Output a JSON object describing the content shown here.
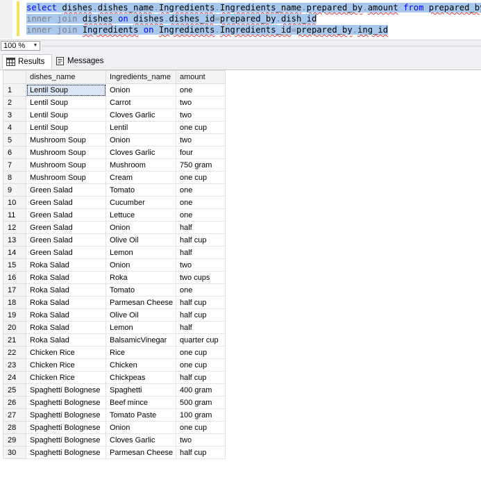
{
  "editor": {
    "line1": {
      "kw1": "select",
      "t1": "dishes",
      "d1": ".",
      "t2": "dishes_name",
      "d2": ".",
      "t3": "Ingredients",
      "d3": ".",
      "t4": "Ingredients_name",
      "d4": ".",
      "t5": "prepared_by",
      "d5": ".",
      "t6": "amount",
      "kw2": "from",
      "t7": "prepared_by"
    },
    "line2": {
      "kw1": "inner join",
      "t1": "dishes",
      "kw2": "on",
      "t2": "dishes",
      "d1": ".",
      "t3": "dishes_id",
      "eq": "=",
      "t4": "prepared_by",
      "d2": ".",
      "t5": "dish_id"
    },
    "line3": {
      "kw1": "inner join",
      "t1": "Ingredients",
      "kw2": "on",
      "t2": "Ingredients",
      "d1": ".",
      "t3": "Ingredients_id",
      "eq": "=",
      "t4": "prepared_by",
      "d2": ".",
      "t5": "ing_id"
    }
  },
  "zoom": {
    "value": "100 %"
  },
  "tabs": {
    "results": "Results",
    "messages": "Messages"
  },
  "grid": {
    "columns": [
      "dishes_name",
      "Ingredients_name",
      "amount"
    ],
    "rows": [
      [
        "1",
        "Lentil Soup",
        "Onion",
        "one"
      ],
      [
        "2",
        "Lentil Soup",
        "Carrot",
        "two"
      ],
      [
        "3",
        "Lentil Soup",
        "Cloves Garlic",
        "two"
      ],
      [
        "4",
        "Lentil Soup",
        "Lentil",
        "one cup"
      ],
      [
        "5",
        "Mushroom Soup",
        "Onion",
        "two"
      ],
      [
        "6",
        "Mushroom Soup",
        "Cloves Garlic",
        "four"
      ],
      [
        "7",
        "Mushroom Soup",
        "Mushroom",
        "750 gram"
      ],
      [
        "8",
        "Mushroom Soup",
        "Cream",
        "one cup"
      ],
      [
        "9",
        "Green Salad",
        "Tomato",
        "one"
      ],
      [
        "10",
        "Green Salad",
        "Cucumber",
        "one"
      ],
      [
        "11",
        "Green Salad",
        "Lettuce",
        "one"
      ],
      [
        "12",
        "Green Salad",
        "Onion",
        "half"
      ],
      [
        "13",
        "Green Salad",
        "Olive Oil",
        "half cup"
      ],
      [
        "14",
        "Green Salad",
        "Lemon",
        "half"
      ],
      [
        "15",
        "Roka Salad",
        "Onion",
        "two"
      ],
      [
        "16",
        "Roka Salad",
        "Roka",
        "two cups"
      ],
      [
        "17",
        "Roka Salad",
        "Tomato",
        "one"
      ],
      [
        "18",
        "Roka Salad",
        "Parmesan Cheese",
        "half cup"
      ],
      [
        "19",
        "Roka Salad",
        "Olive Oil",
        "half cup"
      ],
      [
        "20",
        "Roka Salad",
        "Lemon",
        "half"
      ],
      [
        "21",
        "Roka Salad",
        "BalsamicVinegar",
        "quarter cup"
      ],
      [
        "22",
        "Chicken Rice",
        "Rice",
        "one cup"
      ],
      [
        "23",
        "Chicken Rice",
        "Chicken",
        "one cup"
      ],
      [
        "24",
        "Chicken Rice",
        "Chickpeas",
        "half cup"
      ],
      [
        "25",
        "Spaghetti Bolognese",
        "Spaghetti",
        "400 gram"
      ],
      [
        "26",
        "Spaghetti Bolognese",
        "Beef mince",
        "500 gram"
      ],
      [
        "27",
        "Spaghetti Bolognese",
        "Tomato Paste",
        "100 gram"
      ],
      [
        "28",
        "Spaghetti Bolognese",
        "Onion",
        "one cup"
      ],
      [
        "29",
        "Spaghetti Bolognese",
        "Cloves Garlic",
        "two"
      ],
      [
        "30",
        "Spaghetti Bolognese",
        "Parmesan Cheese",
        "half cup"
      ]
    ]
  }
}
